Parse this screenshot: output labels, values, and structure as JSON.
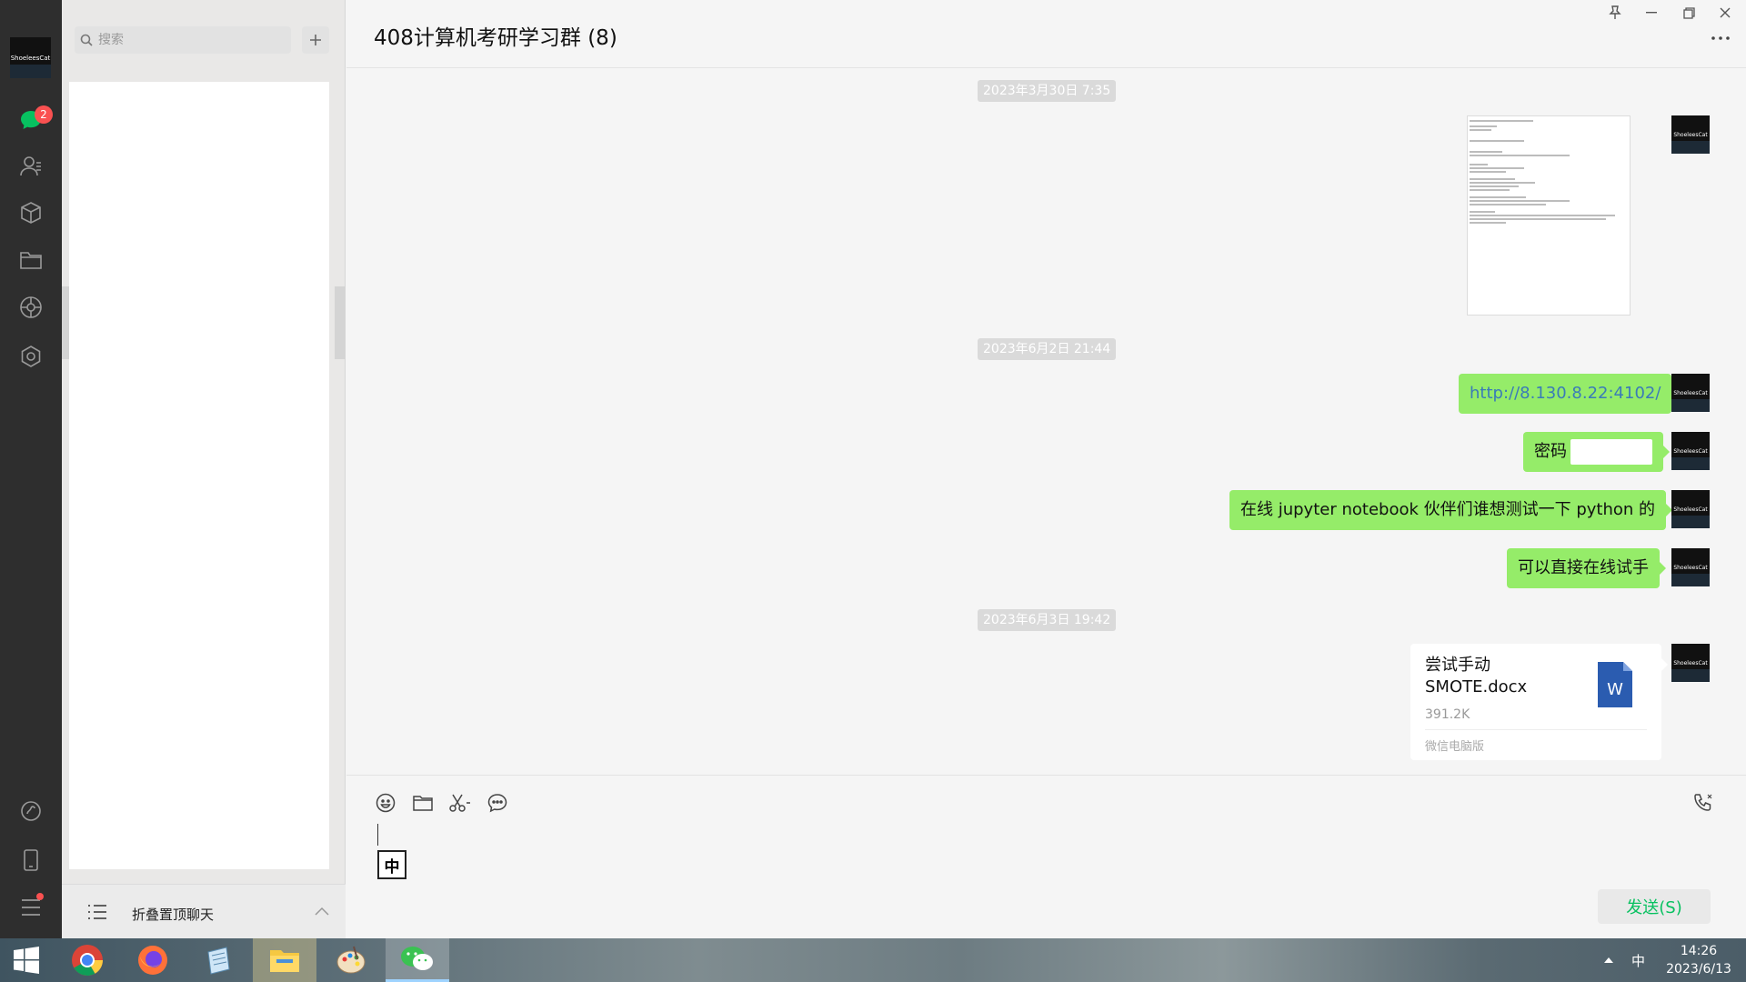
{
  "app": {
    "name": "WeChat"
  },
  "rail": {
    "unread_badge": "2",
    "icons": [
      "chat-icon",
      "contacts-icon",
      "favorites-icon",
      "files-icon",
      "moments-icon",
      "mini-programs-icon",
      "miniprogram-hub-icon",
      "phone-icon",
      "menu-icon"
    ]
  },
  "search": {
    "placeholder": "搜索"
  },
  "list_footer": {
    "label": "折叠置顶聊天"
  },
  "chat": {
    "title": "408计算机考研学习群 (8)",
    "timestamps": [
      "2023年3月30日 7:35",
      "2023年6月2日 21:44",
      "2023年6月3日 19:42"
    ],
    "messages": {
      "link": "http://8.130.8.22:4102/",
      "password_label": "密码",
      "jupyter": "在线 jupyter notebook 伙伴们谁想测试一下 python 的",
      "tryit": "可以直接在线试手"
    },
    "file": {
      "name_line1": "尝试手动",
      "name_line2": "SMOTE.docx",
      "size": "391.2K",
      "source": "微信电脑版",
      "icon_letter": "W"
    },
    "ime_indicator": "中",
    "send_label": "发送(S)"
  },
  "avatar": {
    "label": "ShoeleesCat"
  },
  "taskbar": {
    "apps": [
      "windows-start",
      "chrome",
      "firefox",
      "notepad",
      "file-explorer",
      "paint",
      "wechat"
    ],
    "active": "wechat",
    "ime": "中",
    "time": "14:26",
    "date": "2023/6/13"
  },
  "colors": {
    "bubble_green": "#95ec69",
    "link_blue": "#3a7bb8",
    "send_green": "#07c160",
    "badge_red": "#fa5151",
    "rail_dark": "#2e2e2e"
  }
}
